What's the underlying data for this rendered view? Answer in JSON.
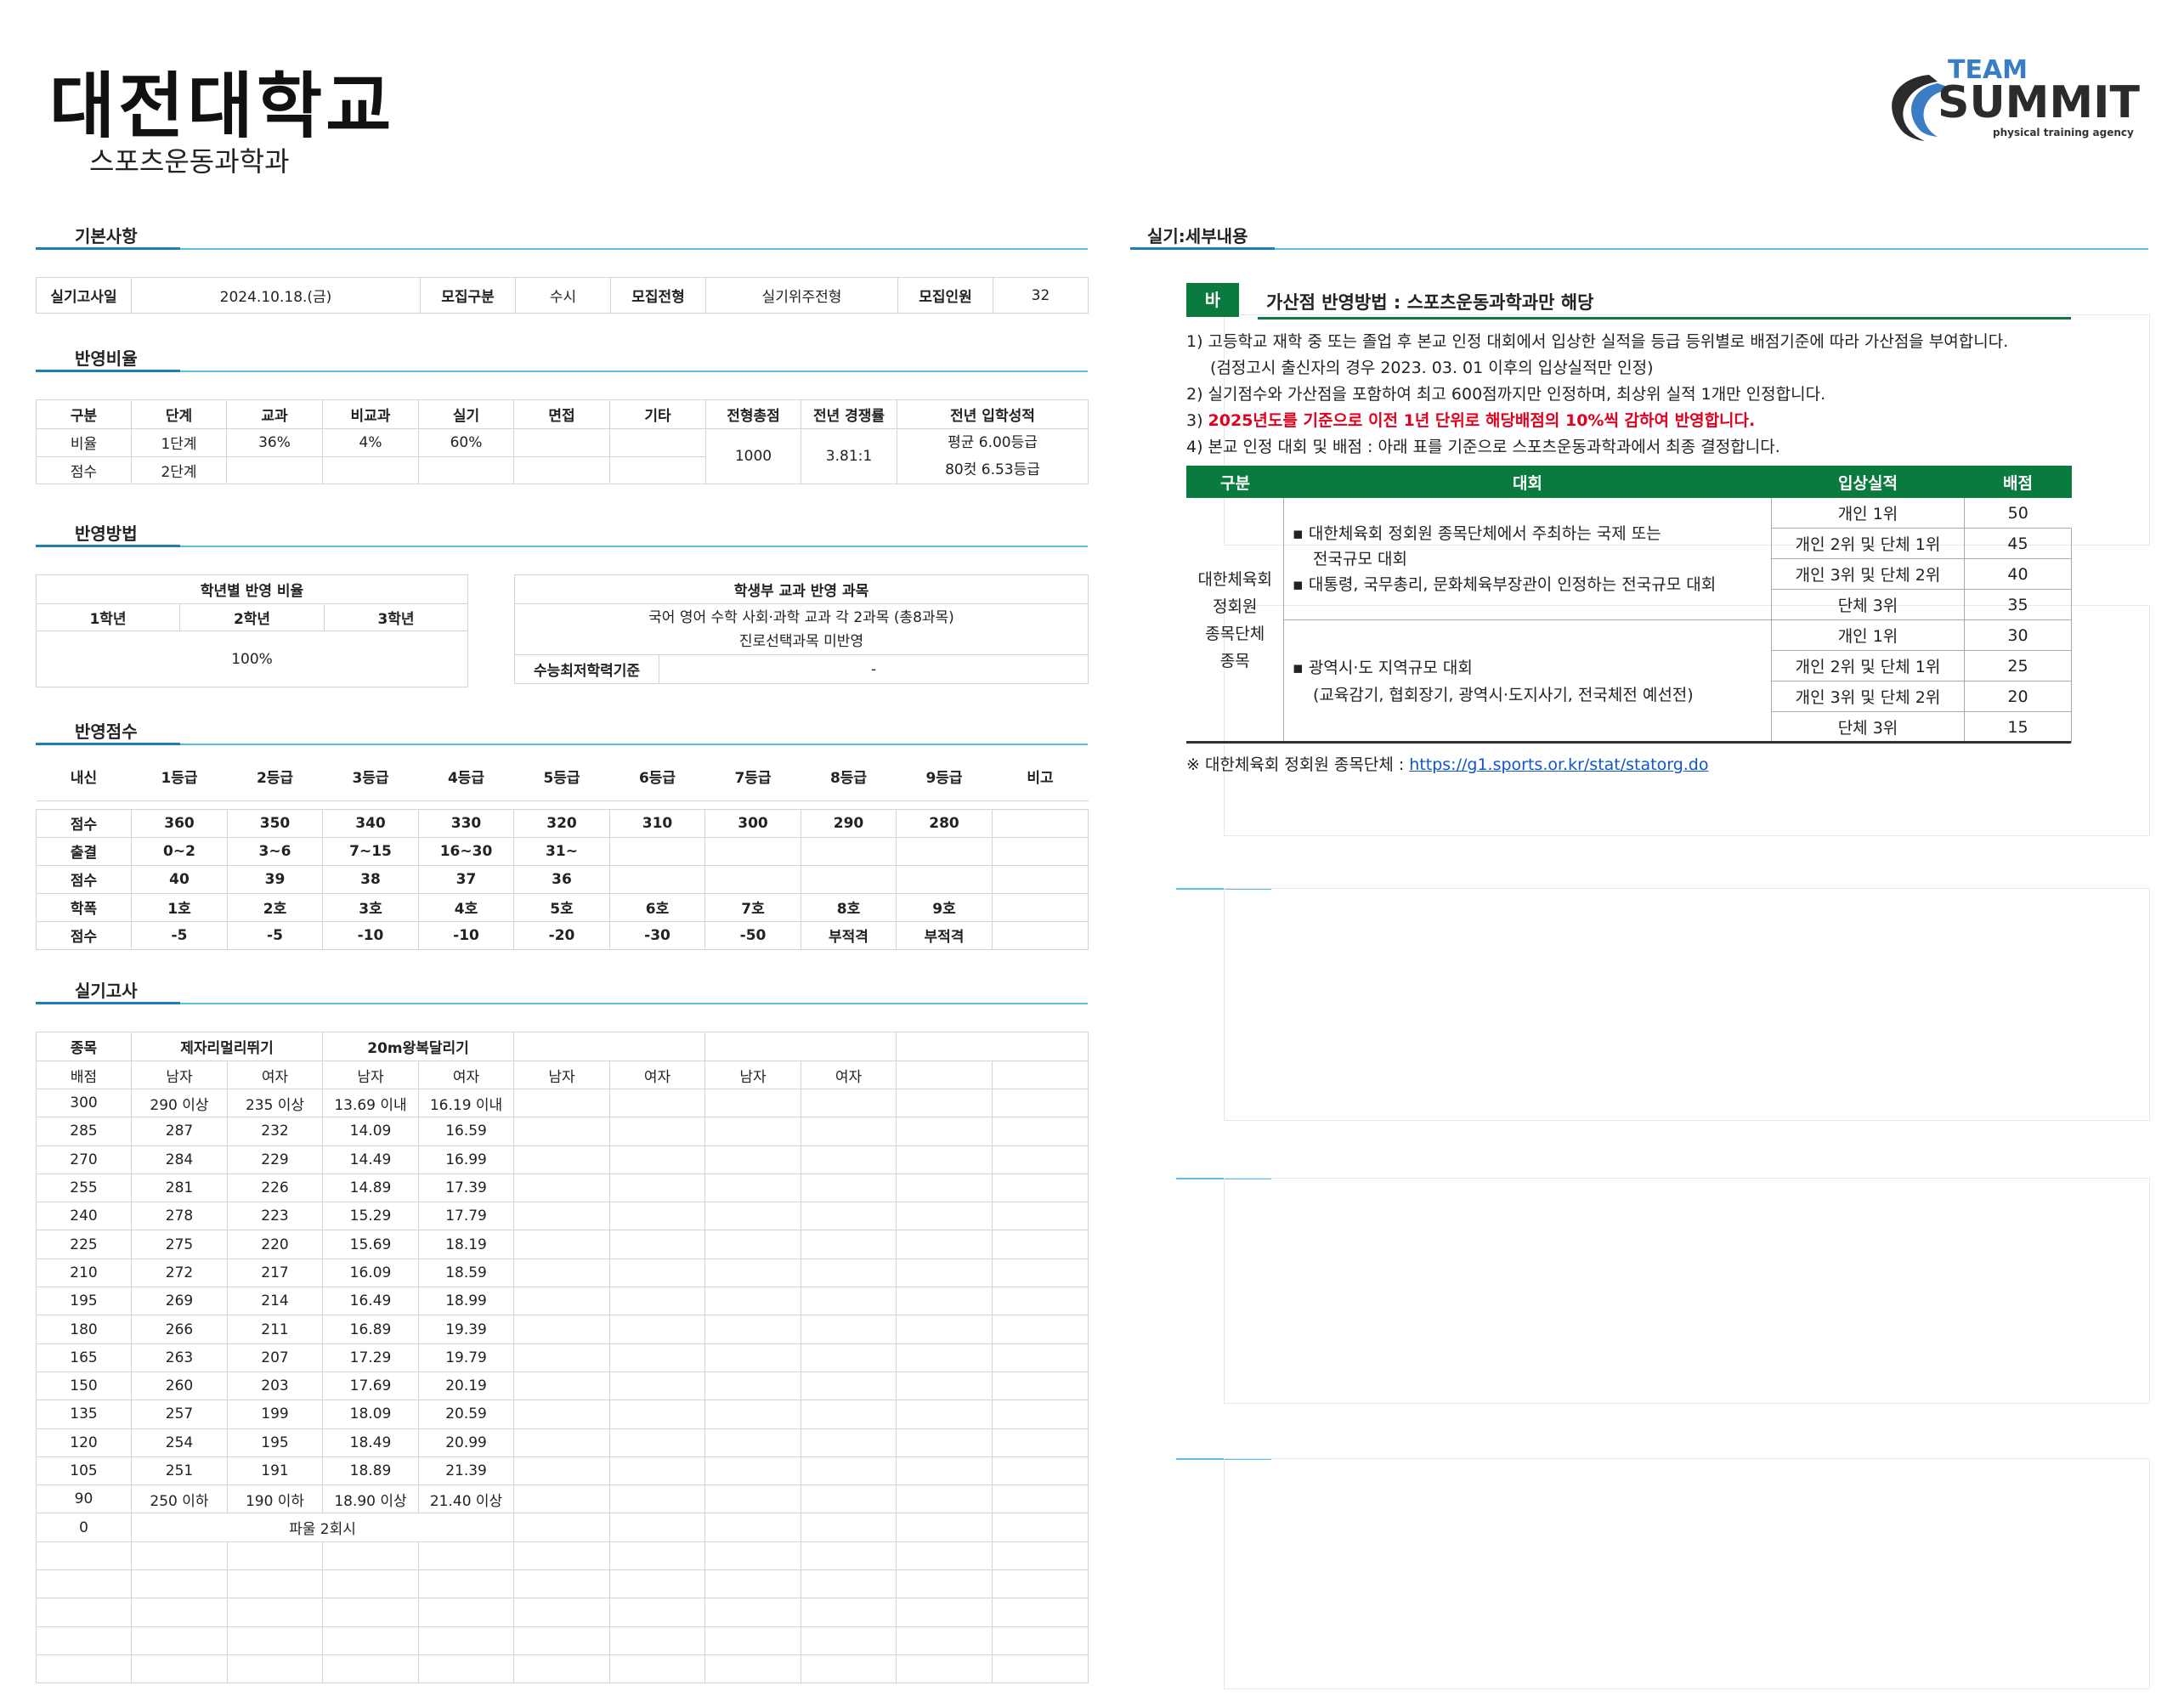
{
  "header": {
    "school": "대전대학교",
    "department": "스포츠운동과학과",
    "logo": {
      "line1": "TEAM",
      "line2": "SUMMIT",
      "tagline": "physical training agency"
    }
  },
  "basic": {
    "title": "기본사항",
    "cells": [
      "실기고사일",
      "2024.10.18.(금)",
      "모집구분",
      "수시",
      "모집전형",
      "실기위주전형",
      "모집인원",
      "32"
    ]
  },
  "ratio": {
    "title": "반영비율",
    "headers": [
      "구분",
      "단계",
      "교과",
      "비교과",
      "실기",
      "면접",
      "기타",
      "전형총점",
      "전년 경쟁률",
      "전년 입학성적"
    ],
    "row1": [
      "비율",
      "1단계",
      "36%",
      "4%",
      "60%",
      "",
      ""
    ],
    "row2": [
      "점수",
      "2단계",
      "",
      "",
      "",
      "",
      ""
    ],
    "total": "1000",
    "competition": "3.81:1",
    "prev_grade": [
      "평균 6.00등급",
      "80컷 6.53등급"
    ]
  },
  "method": {
    "title": "반영방법",
    "grade_title": "학년별 반영 비율",
    "grades": [
      "1학년",
      "2학년",
      "3학년"
    ],
    "grade_value": "100%",
    "subject_title": "학생부 교과 반영 과목",
    "subject_lines": [
      "국어 영어 수학 사회·과학 교과 각 2과목 (총8과목)",
      "진로선택과목 미반영"
    ],
    "csat_label": "수능최저학력기준",
    "csat_value": "-"
  },
  "score": {
    "title": "반영점수",
    "headers": [
      "내신",
      "1등급",
      "2등급",
      "3등급",
      "4등급",
      "5등급",
      "6등급",
      "7등급",
      "8등급",
      "9등급",
      "비고"
    ],
    "rows": [
      [
        "점수",
        "360",
        "350",
        "340",
        "330",
        "320",
        "310",
        "300",
        "290",
        "280",
        ""
      ],
      [
        "출결",
        "0~2",
        "3~6",
        "7~15",
        "16~30",
        "31~",
        "",
        "",
        "",
        "",
        ""
      ],
      [
        "점수",
        "40",
        "39",
        "38",
        "37",
        "36",
        "",
        "",
        "",
        "",
        ""
      ],
      [
        "학폭",
        "1호",
        "2호",
        "3호",
        "4호",
        "5호",
        "6호",
        "7호",
        "8호",
        "9호",
        ""
      ],
      [
        "점수",
        "-5",
        "-5",
        "-10",
        "-10",
        "-20",
        "-30",
        "-50",
        "부적격",
        "부적격",
        ""
      ]
    ]
  },
  "practical": {
    "title": "실기고사",
    "head1": [
      "종목",
      "제자리멀리뛰기",
      "20m왕복달리기"
    ],
    "head2": [
      "배점",
      "남자",
      "여자",
      "남자",
      "여자",
      "남자",
      "여자",
      "남자",
      "여자"
    ],
    "rows": [
      [
        "300",
        "290 이상",
        "235 이상",
        "13.69 이내",
        "16.19 이내"
      ],
      [
        "285",
        "287",
        "232",
        "14.09",
        "16.59"
      ],
      [
        "270",
        "284",
        "229",
        "14.49",
        "16.99"
      ],
      [
        "255",
        "281",
        "226",
        "14.89",
        "17.39"
      ],
      [
        "240",
        "278",
        "223",
        "15.29",
        "17.79"
      ],
      [
        "225",
        "275",
        "220",
        "15.69",
        "18.19"
      ],
      [
        "210",
        "272",
        "217",
        "16.09",
        "18.59"
      ],
      [
        "195",
        "269",
        "214",
        "16.49",
        "18.99"
      ],
      [
        "180",
        "266",
        "211",
        "16.89",
        "19.39"
      ],
      [
        "165",
        "263",
        "207",
        "17.29",
        "19.79"
      ],
      [
        "150",
        "260",
        "203",
        "17.69",
        "20.19"
      ],
      [
        "135",
        "257",
        "199",
        "18.09",
        "20.59"
      ],
      [
        "120",
        "254",
        "195",
        "18.49",
        "20.99"
      ],
      [
        "105",
        "251",
        "191",
        "18.89",
        "21.39"
      ],
      [
        "90",
        "250 이하",
        "190 이하",
        "18.90 이상",
        "21.40 이상"
      ]
    ],
    "foul_row": [
      "0",
      "파울 2회시"
    ]
  },
  "detail": {
    "title": "실기:세부내용",
    "badge": "바",
    "heading": "가산점 반영방법 : 스포츠운동과학과만 해당",
    "lines": [
      "1) 고등학교 재학 중 또는 졸업 후 본교 인정 대회에서 입상한 실적을 등급 등위별로 배점기준에 따라 가산점을 부여합니다.",
      "(검정고시 출신자의 경우 2023. 03. 01 이후의 입상실적만 인정)",
      "2) 실기점수와 가산점을 포함하여 최고 600점까지만 인정하며, 최상위 실적 1개만 인정합니다.",
      "4) 본교 인정 대회 및 배점 : 아래 표를 기준으로 스포츠운동과학과에서 최종 결정합니다."
    ],
    "line3_prefix": "3) ",
    "line3_red": "2025년도를 기준으로 이전 1년 단위로 해당배점의 10%씩 감하여 반영합니다.",
    "table_headers": [
      "구분",
      "대회",
      "입상실적",
      "배점"
    ],
    "category": [
      "대한체육회",
      "정회원",
      "종목단체",
      "종목"
    ],
    "group1_lines": [
      "▪ 대한체육회 정회원 종목단체에서 주최하는 국제 또는",
      "전국규모 대회",
      "▪ 대통령, 국무총리, 문화체육부장관이 인정하는 전국규모 대회"
    ],
    "group2_lines": [
      "▪ 광역시·도 지역규모 대회",
      "(교육감기, 협회장기, 광역시·도지사기, 전국체전 예선전)"
    ],
    "awards": [
      [
        "개인 1위",
        "50"
      ],
      [
        "개인 2위 및 단체 1위",
        "45"
      ],
      [
        "개인 3위 및 단체 2위",
        "40"
      ],
      [
        "단체 3위",
        "35"
      ],
      [
        "개인 1위",
        "30"
      ],
      [
        "개인 2위 및 단체 1위",
        "25"
      ],
      [
        "개인 3위 및 단체 2위",
        "20"
      ],
      [
        "단체 3위",
        "15"
      ]
    ],
    "note_prefix": "※ 대한체육회 정회원 종목단체 : ",
    "note_link": "https://g1.sports.or.kr/stat/statorg.do"
  },
  "colors": {
    "accent_line": "#5bc0e8",
    "green": "#0b7a3e",
    "red": "#e1001e",
    "logo_blue": "#2b6fb5"
  }
}
